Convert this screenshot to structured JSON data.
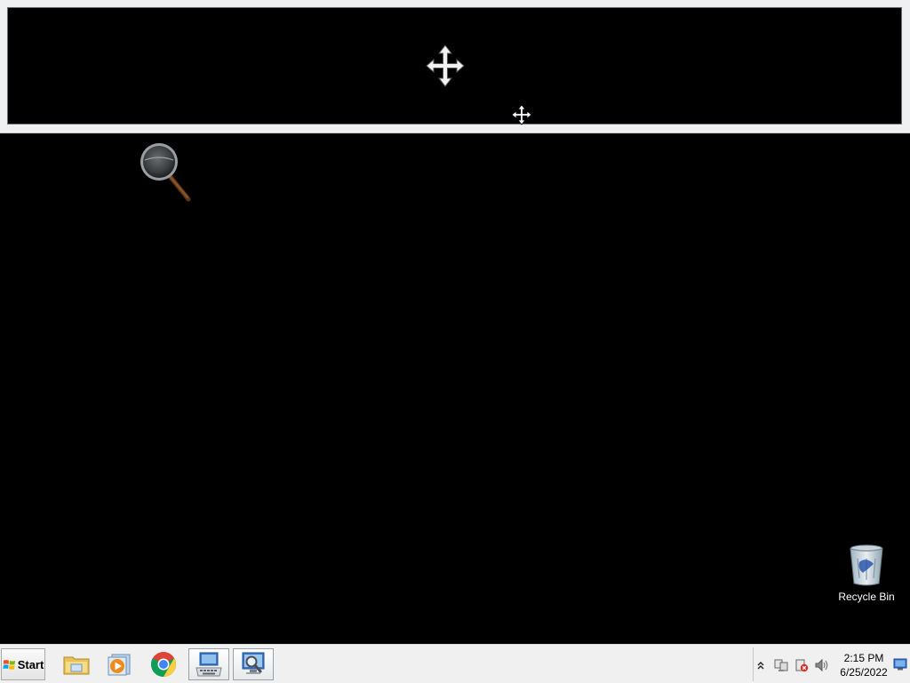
{
  "desktop": {
    "icons": [
      {
        "name": "magnifier-lens-icon"
      },
      {
        "name": "recycle-bin",
        "label": "Recycle Bin"
      }
    ]
  },
  "magnifier": {
    "view_background": "#000000",
    "frame_color": "#eef0f2"
  },
  "taskbar": {
    "start_label": "Start",
    "pinned": [
      {
        "name": "file-explorer-icon"
      },
      {
        "name": "media-player-icon"
      },
      {
        "name": "chrome-icon"
      },
      {
        "name": "on-screen-keyboard-icon"
      },
      {
        "name": "magnifier-app-icon"
      }
    ],
    "tray": {
      "icons": [
        "show-hidden-icons-chevron",
        "network-icon",
        "action-center-icon",
        "volume-icon",
        "show-desktop-icon"
      ],
      "time": "2:15 PM",
      "date": "6/25/2022"
    }
  },
  "colors": {
    "taskbar_bg": "#f0f0f0",
    "desktop_bg": "#000000",
    "accent": "#1a73e8"
  }
}
